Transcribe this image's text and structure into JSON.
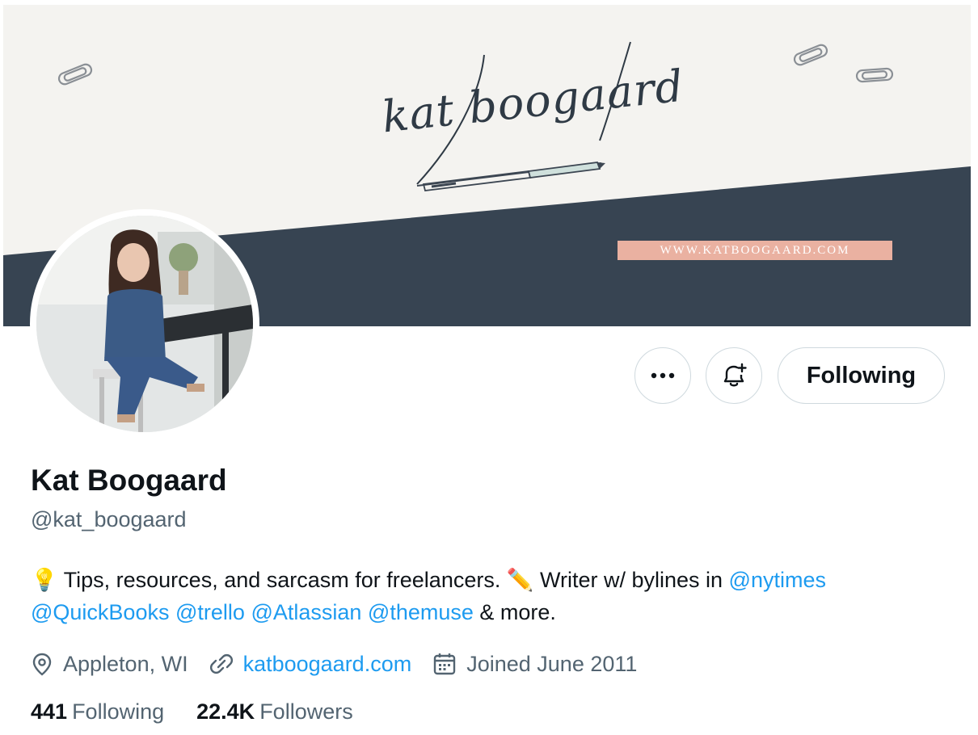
{
  "banner": {
    "signature": "kat boogaard",
    "website_tag": "WWW.KATBOOGAARD.COM"
  },
  "actions": {
    "more_label": "...",
    "following_label": "Following"
  },
  "profile": {
    "name": "Kat Boogaard",
    "handle": "@kat_boogaard",
    "bio": {
      "emoji_1": "💡",
      "text_1": " Tips, resources, and sarcasm for freelancers. ",
      "emoji_2": "✏️",
      "text_2": " Writer w/ bylines in ",
      "mention_1": "@nytimes",
      "mention_2": "@QuickBooks",
      "mention_3": "@trello",
      "mention_4": "@Atlassian",
      "mention_5": "@themuse",
      "text_3": " & more."
    },
    "location": "Appleton, WI",
    "website": "katboogaard.com",
    "joined": "Joined June 2011",
    "following_count": "441",
    "following_label": "Following",
    "followers_count": "22.4K",
    "followers_label": "Followers"
  },
  "icons": {
    "location": "location-pin-icon",
    "link": "link-icon",
    "calendar": "calendar-icon",
    "bell": "notification-bell-plus-icon",
    "more": "more-options-icon"
  },
  "colors": {
    "banner_light": "#f4f3f0",
    "banner_dark": "#374452",
    "tag_bg": "#eab1a1",
    "link_blue": "#1d9bf0",
    "secondary_text": "#536471"
  }
}
